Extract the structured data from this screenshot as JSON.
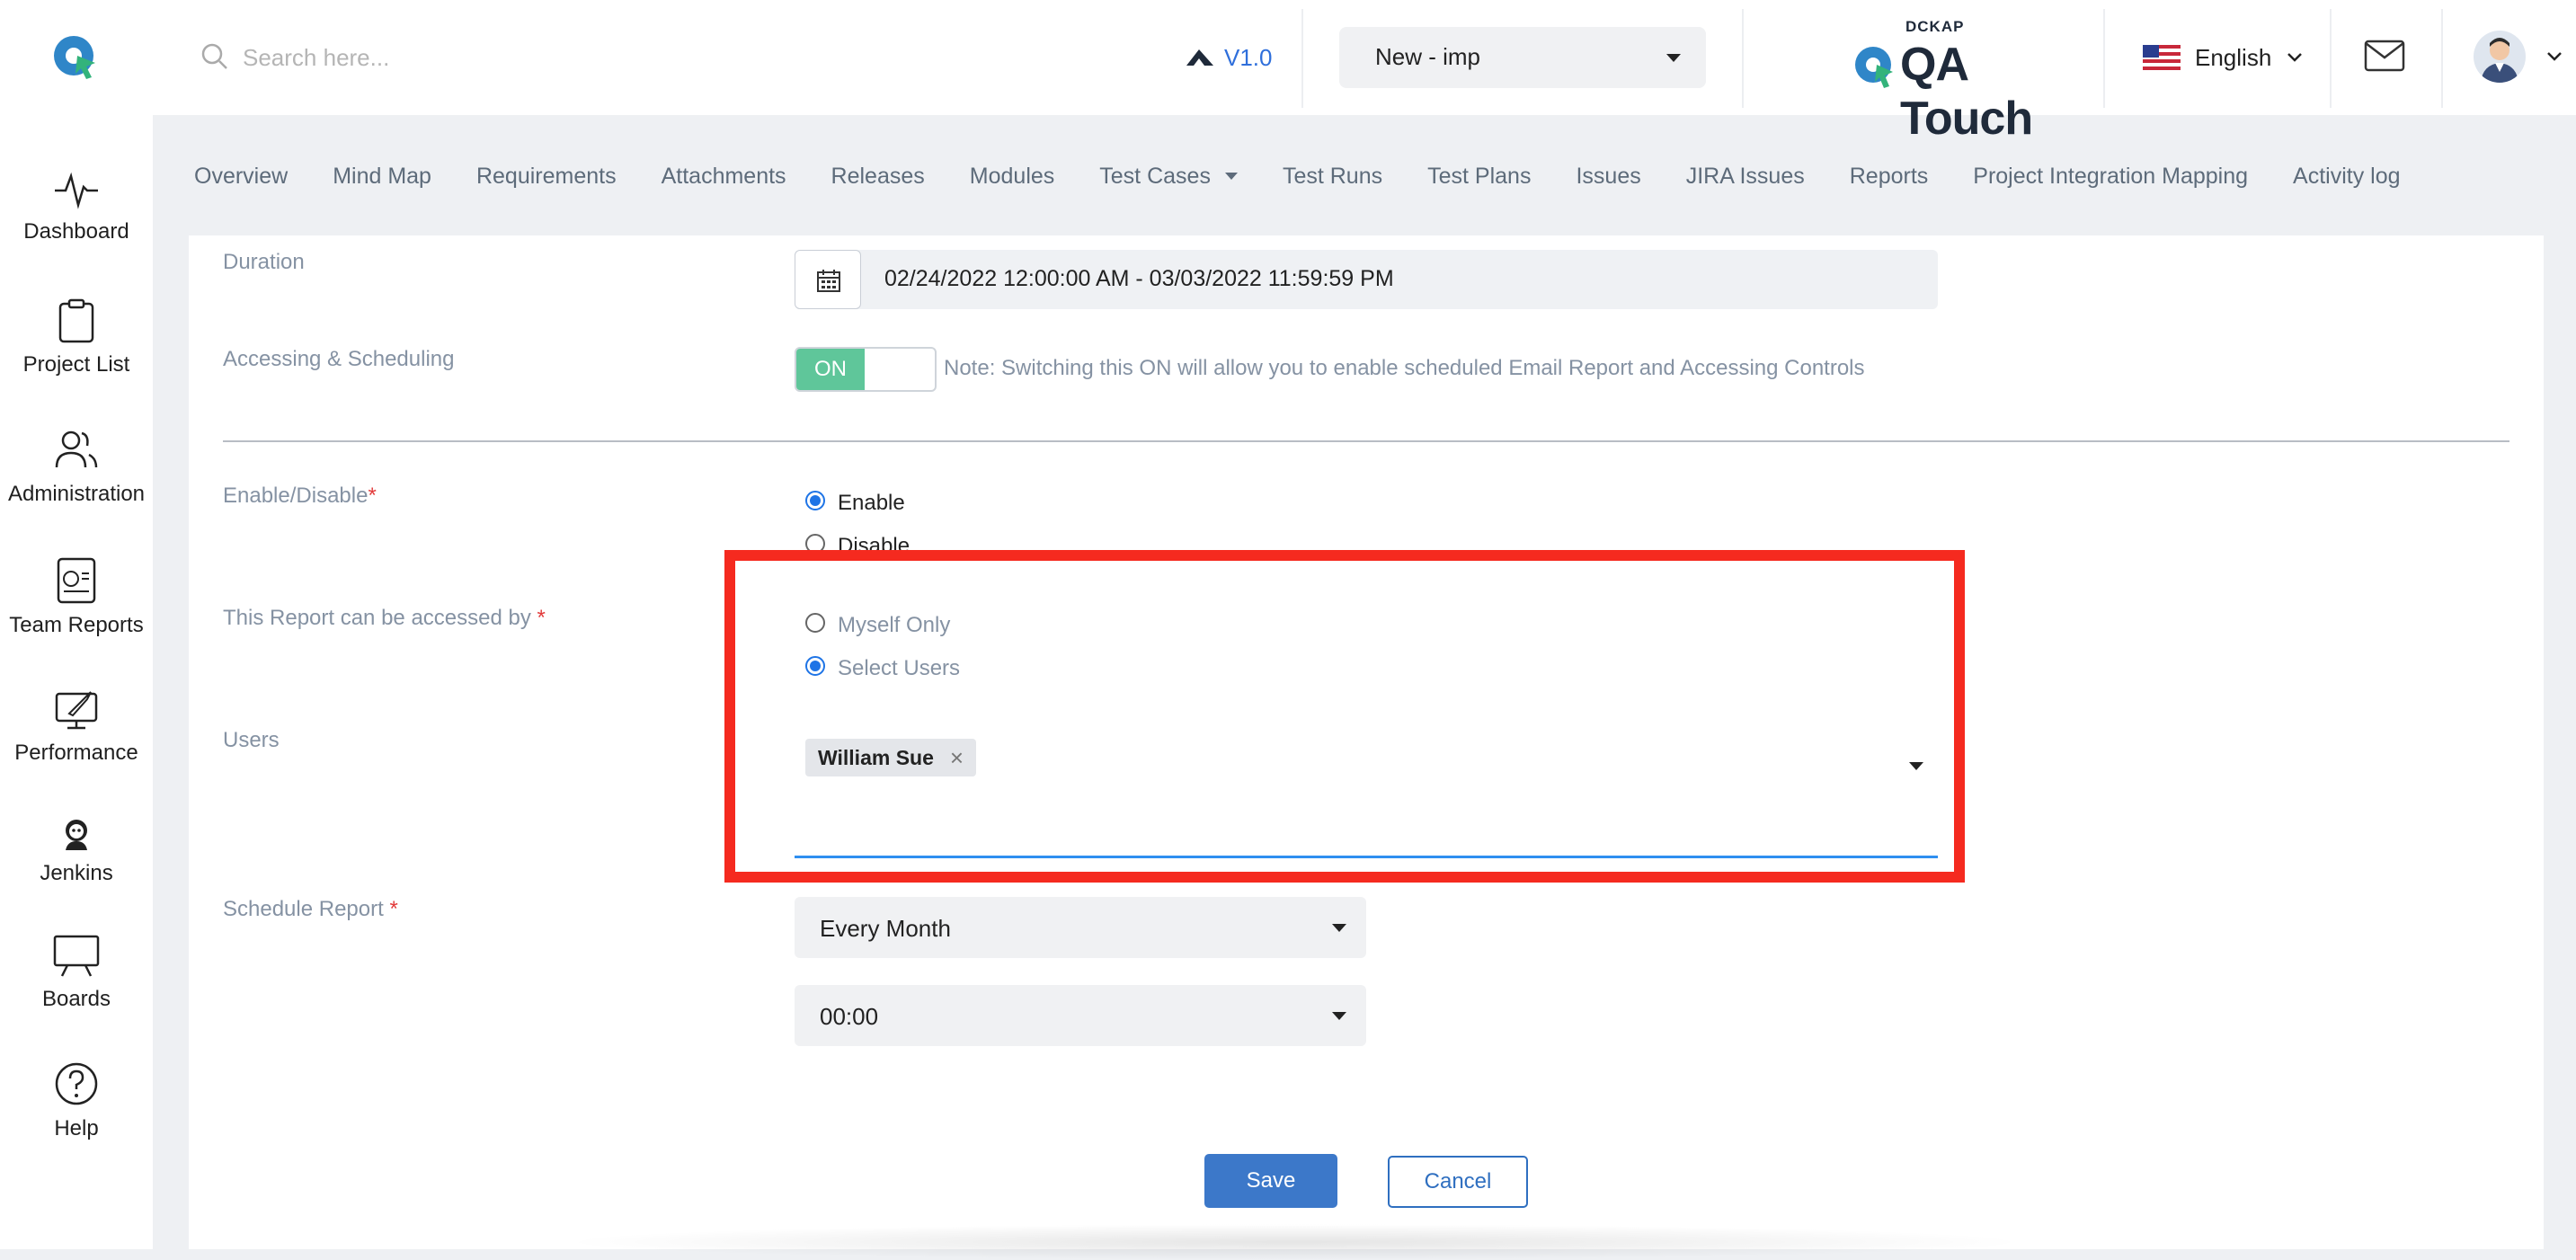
{
  "header": {
    "search_placeholder": "Search here...",
    "version": "V1.0",
    "project_select": "New - imp",
    "brand_small": "DCKAP",
    "brand_name": "QA Touch",
    "language": "English"
  },
  "sidebar": {
    "items": [
      {
        "label": "Dashboard",
        "icon": "pulse-icon"
      },
      {
        "label": "Project List",
        "icon": "clipboard-icon"
      },
      {
        "label": "Administration",
        "icon": "users-icon"
      },
      {
        "label": "Team Reports",
        "icon": "report-icon"
      },
      {
        "label": "Performance",
        "icon": "rocket-icon"
      },
      {
        "label": "Jenkins",
        "icon": "jenkins-icon"
      },
      {
        "label": "Boards",
        "icon": "board-icon"
      },
      {
        "label": "Help",
        "icon": "help-icon"
      }
    ]
  },
  "nav": {
    "tabs": [
      "Overview",
      "Mind Map",
      "Requirements",
      "Attachments",
      "Releases",
      "Modules",
      "Test Cases",
      "Test Runs",
      "Test Plans",
      "Issues",
      "JIRA Issues",
      "Reports",
      "Project Integration Mapping",
      "Activity log"
    ]
  },
  "form": {
    "duration_label": "Duration",
    "duration_value": "02/24/2022 12:00:00 AM - 03/03/2022 11:59:59 PM",
    "access_sched_label": "Accessing & Scheduling",
    "toggle_label": "ON",
    "toggle_note": "Note: Switching this ON will allow you to enable scheduled Email Report and Accessing Controls",
    "enable_label": "Enable/Disable",
    "enable_option": "Enable",
    "disable_option": "Disable",
    "accessed_by_label": "This Report can be accessed by",
    "myself_option": "Myself Only",
    "select_users_option": "Select Users",
    "users_label": "Users",
    "selected_user": "William Sue",
    "schedule_label": "Schedule Report",
    "schedule_value": "Every Month",
    "time_value": "00:00",
    "required_mark": "*"
  },
  "actions": {
    "save": "Save",
    "cancel": "Cancel"
  },
  "colors": {
    "accent": "#3c78c9",
    "toggle_on": "#5fc69a",
    "highlight": "#f52a1f",
    "required": "#e23b3b"
  }
}
